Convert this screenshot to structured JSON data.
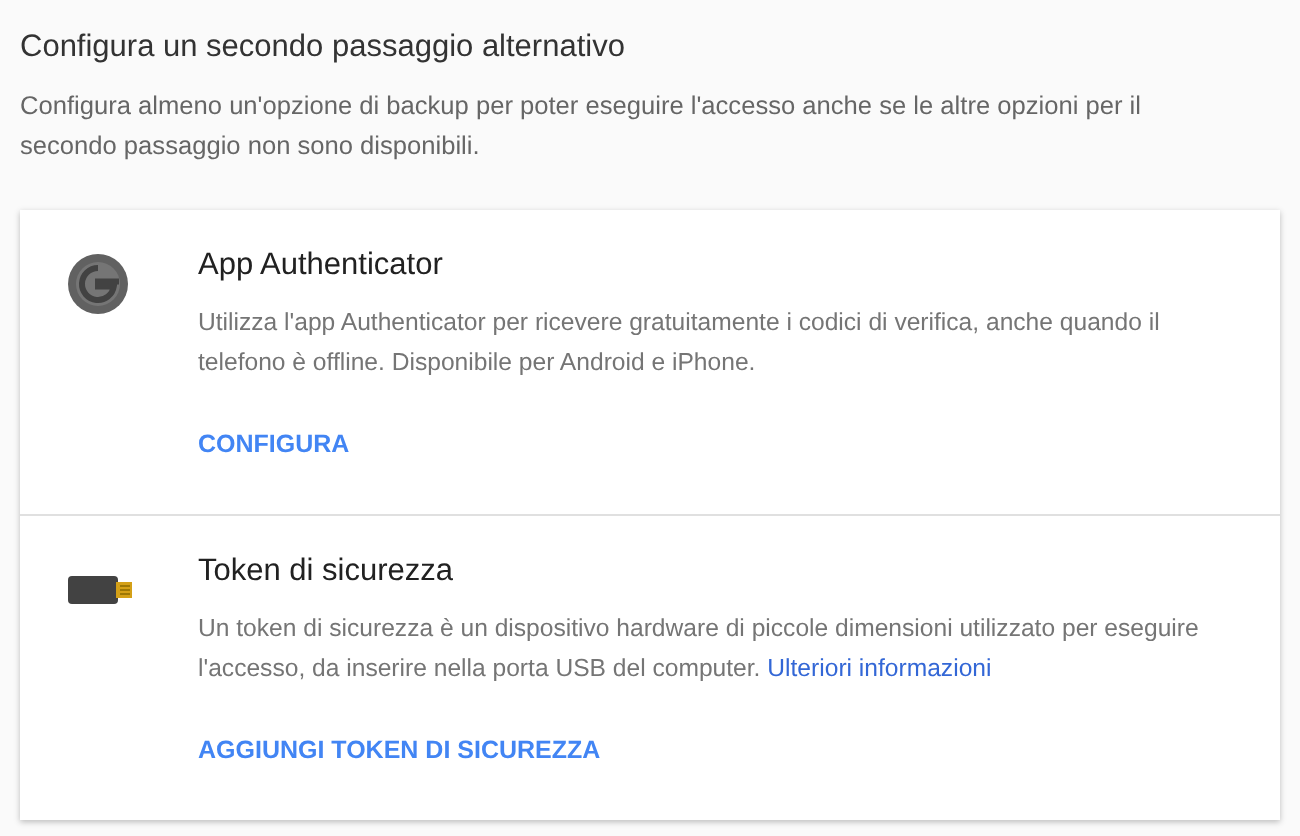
{
  "heading": "Configura un secondo passaggio alternativo",
  "intro": "Configura almeno un'opzione di backup per poter eseguire l'accesso anche se le altre opzioni per il secondo passaggio non sono disponibili.",
  "options": [
    {
      "kind": "authenticator",
      "title": "App Authenticator",
      "description": "Utilizza l'app Authenticator per ricevere gratuitamente i codici di verifica, anche quando il telefono è offline. Disponibile per Android e iPhone.",
      "action": "CONFIGURA"
    },
    {
      "kind": "token",
      "title": "Token di sicurezza",
      "description": "Un token di sicurezza è un dispositivo hardware di piccole dimensioni utilizzato per eseguire l'accesso, da inserire nella porta USB del computer.",
      "link": "Ulteriori informazioni",
      "action": "AGGIUNGI TOKEN DI SICUREZZA"
    }
  ]
}
